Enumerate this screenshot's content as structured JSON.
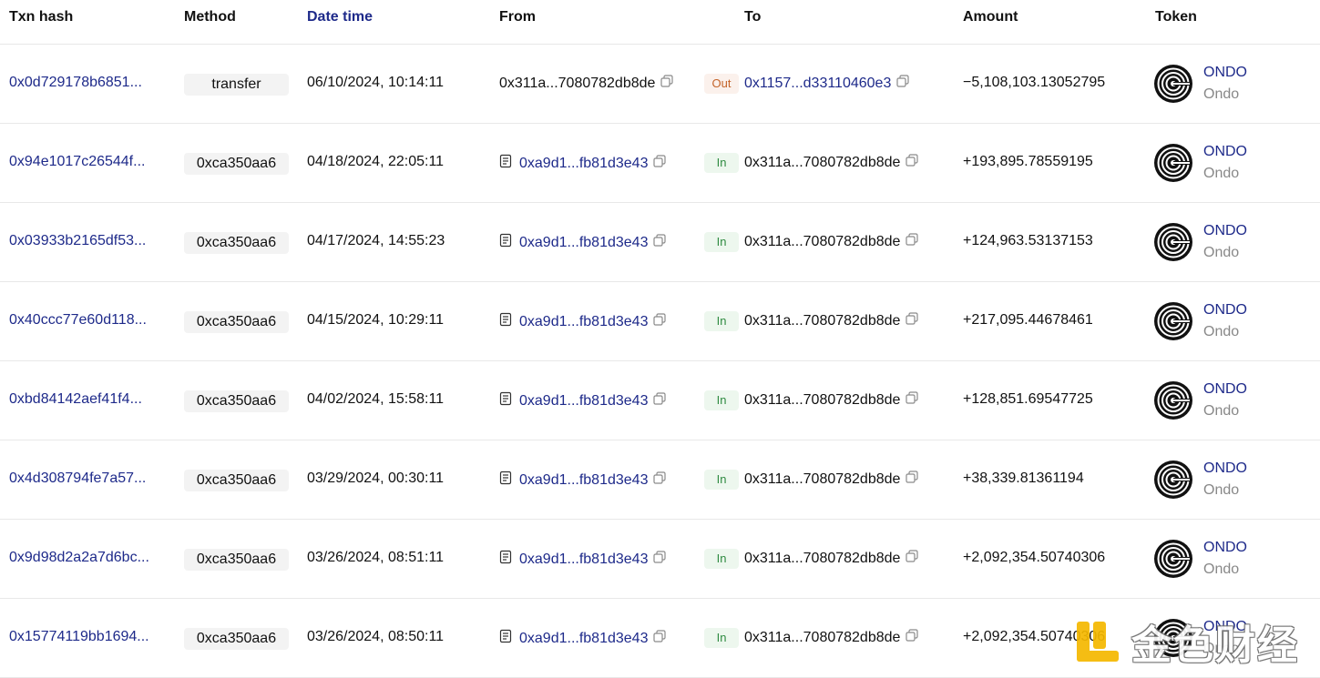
{
  "header": {
    "txn_hash": "Txn hash",
    "method": "Method",
    "date_time": "Date time",
    "from": "From",
    "to": "To",
    "amount": "Amount",
    "token": "Token"
  },
  "rows": [
    {
      "hash": "0x0d729178b6851...",
      "method": "transfer",
      "datetime": "06/10/2024, 10:14:11",
      "from": "0x311a...7080782db8de",
      "from_contract": false,
      "direction": "Out",
      "to": "0x1157...d33110460e3",
      "to_link": true,
      "amount": "−5,108,103.13052795",
      "token_symbol": "ONDO",
      "token_name": "Ondo"
    },
    {
      "hash": "0x94e1017c26544f...",
      "method": "0xca350aa6",
      "datetime": "04/18/2024, 22:05:11",
      "from": "0xa9d1...fb81d3e43",
      "from_contract": true,
      "direction": "In",
      "to": "0x311a...7080782db8de",
      "to_link": false,
      "amount": "+193,895.78559195",
      "token_symbol": "ONDO",
      "token_name": "Ondo"
    },
    {
      "hash": "0x03933b2165df53...",
      "method": "0xca350aa6",
      "datetime": "04/17/2024, 14:55:23",
      "from": "0xa9d1...fb81d3e43",
      "from_contract": true,
      "direction": "In",
      "to": "0x311a...7080782db8de",
      "to_link": false,
      "amount": "+124,963.53137153",
      "token_symbol": "ONDO",
      "token_name": "Ondo"
    },
    {
      "hash": "0x40ccc77e60d118...",
      "method": "0xca350aa6",
      "datetime": "04/15/2024, 10:29:11",
      "from": "0xa9d1...fb81d3e43",
      "from_contract": true,
      "direction": "In",
      "to": "0x311a...7080782db8de",
      "to_link": false,
      "amount": "+217,095.44678461",
      "token_symbol": "ONDO",
      "token_name": "Ondo"
    },
    {
      "hash": "0xbd84142aef41f4...",
      "method": "0xca350aa6",
      "datetime": "04/02/2024, 15:58:11",
      "from": "0xa9d1...fb81d3e43",
      "from_contract": true,
      "direction": "In",
      "to": "0x311a...7080782db8de",
      "to_link": false,
      "amount": "+128,851.69547725",
      "token_symbol": "ONDO",
      "token_name": "Ondo"
    },
    {
      "hash": "0x4d308794fe7a57...",
      "method": "0xca350aa6",
      "datetime": "03/29/2024, 00:30:11",
      "from": "0xa9d1...fb81d3e43",
      "from_contract": true,
      "direction": "In",
      "to": "0x311a...7080782db8de",
      "to_link": false,
      "amount": "+38,339.81361194",
      "token_symbol": "ONDO",
      "token_name": "Ondo"
    },
    {
      "hash": "0x9d98d2a2a7d6bc...",
      "method": "0xca350aa6",
      "datetime": "03/26/2024, 08:51:11",
      "from": "0xa9d1...fb81d3e43",
      "from_contract": true,
      "direction": "In",
      "to": "0x311a...7080782db8de",
      "to_link": false,
      "amount": "+2,092,354.50740306",
      "token_symbol": "ONDO",
      "token_name": "Ondo"
    },
    {
      "hash": "0x15774119bb1694...",
      "method": "0xca350aa6",
      "datetime": "03/26/2024, 08:50:11",
      "from": "0xa9d1...fb81d3e43",
      "from_contract": true,
      "direction": "In",
      "to": "0x311a...7080782db8de",
      "to_link": false,
      "amount": "+2,092,354.50740306",
      "token_symbol": "ONDO",
      "token_name": "Ondo"
    }
  ],
  "icons": {
    "copy": "copy-icon",
    "contract": "contract-icon",
    "token_logo": "ondo-logo-icon"
  },
  "colors": {
    "link": "#1e2a8a",
    "out_text": "#c4642a",
    "out_bg": "#fbf1ec",
    "in_text": "#2e8a40",
    "in_bg": "#edf7ee",
    "muted": "#888888"
  },
  "watermark": {
    "text": "金色财经"
  }
}
